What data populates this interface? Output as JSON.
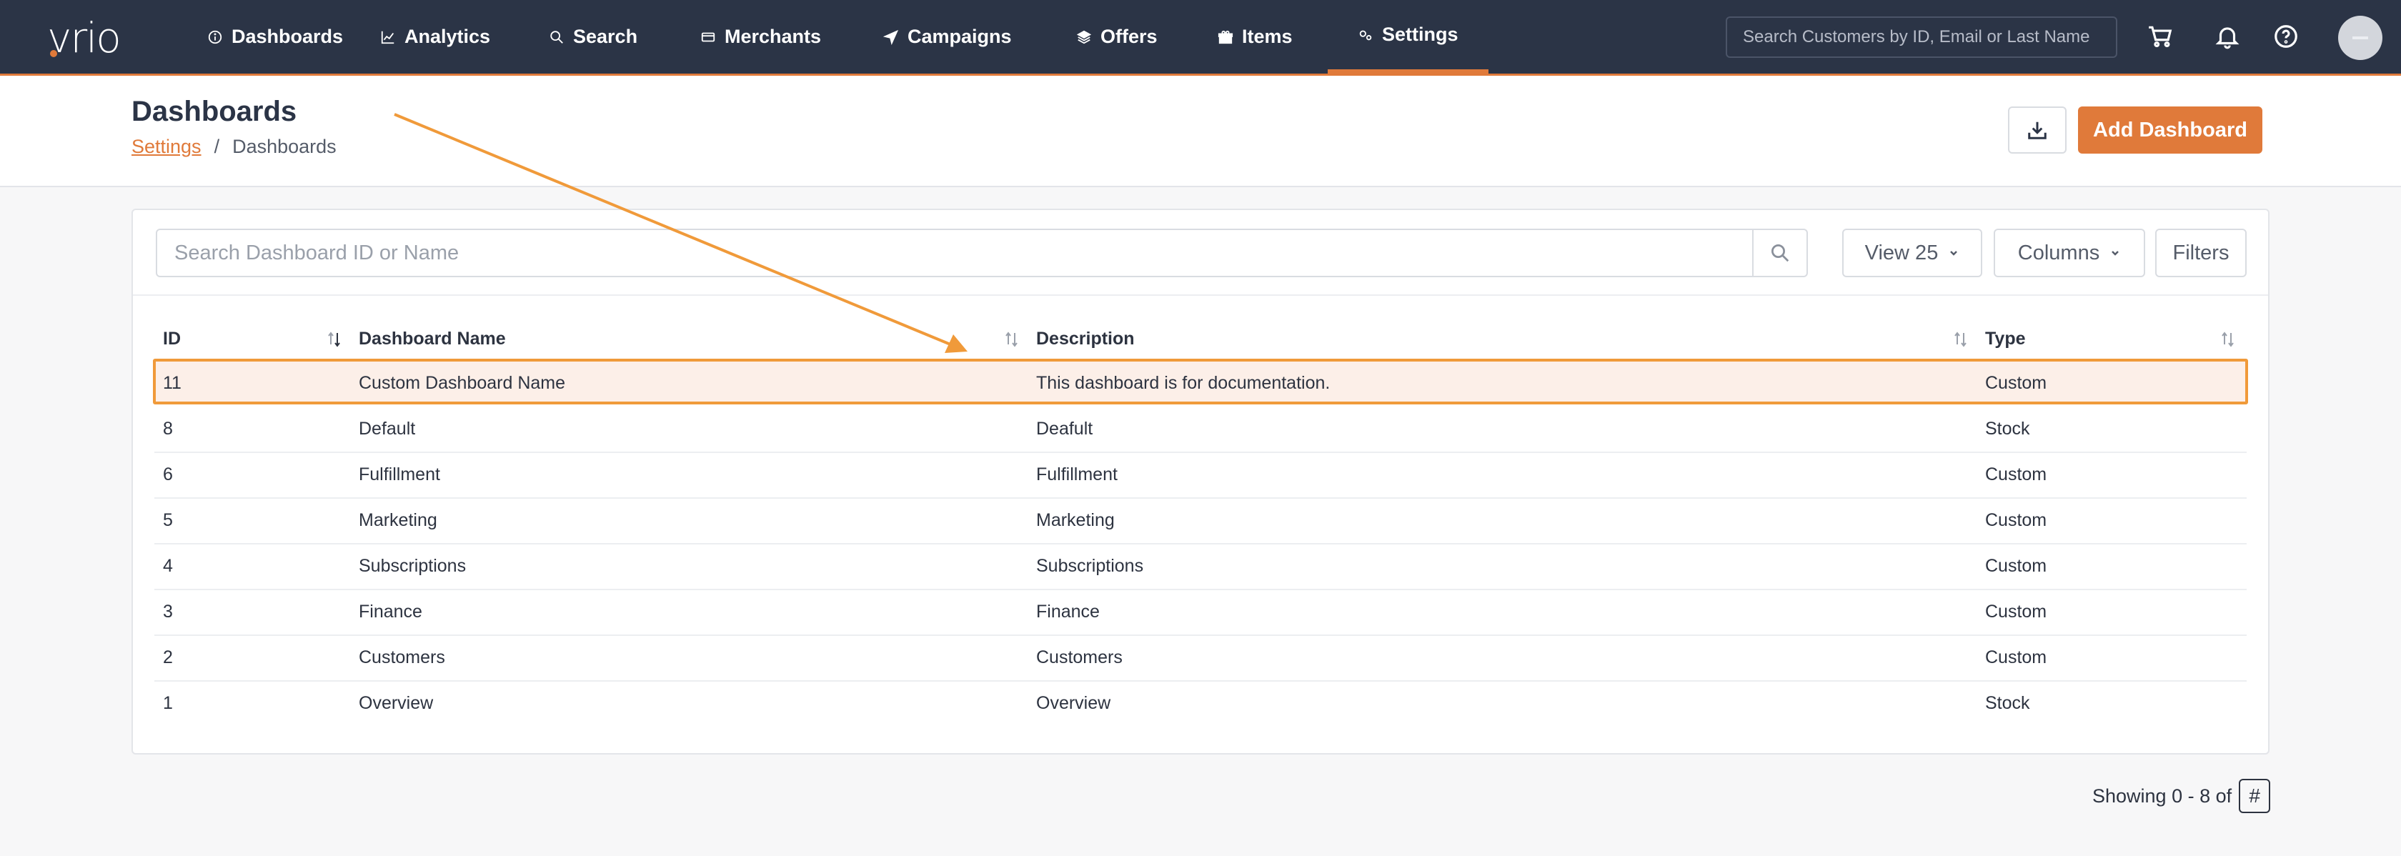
{
  "app": {
    "logo": "vrio"
  },
  "nav": {
    "items": [
      {
        "label": "Dashboards",
        "icon": "info-circle-icon"
      },
      {
        "label": "Analytics",
        "icon": "line-chart-icon"
      },
      {
        "label": "Search",
        "icon": "search-icon"
      },
      {
        "label": "Merchants",
        "icon": "card-icon"
      },
      {
        "label": "Campaigns",
        "icon": "paper-plane-icon"
      },
      {
        "label": "Offers",
        "icon": "layers-icon"
      },
      {
        "label": "Items",
        "icon": "gift-icon"
      },
      {
        "label": "Settings",
        "icon": "gears-icon",
        "active": true
      }
    ],
    "search_placeholder": "Search Customers by ID, Email or Last Name"
  },
  "header": {
    "title": "Dashboards",
    "breadcrumb": {
      "link": "Settings",
      "separator": "/",
      "current": "Dashboards"
    },
    "add_button": "Add Dashboard"
  },
  "toolbar": {
    "search_placeholder": "Search Dashboard ID or Name",
    "view": "View 25",
    "columns": "Columns",
    "filters": "Filters"
  },
  "table": {
    "columns": [
      "ID",
      "Dashboard Name",
      "Description",
      "Type"
    ],
    "rows": [
      {
        "id": "11",
        "name": "Custom Dashboard Name",
        "description": "This dashboard is for documentation.",
        "type": "Custom",
        "highlighted": true
      },
      {
        "id": "8",
        "name": "Default",
        "description": "Deafult",
        "type": "Stock"
      },
      {
        "id": "6",
        "name": "Fulfillment",
        "description": "Fulfillment",
        "type": "Custom"
      },
      {
        "id": "5",
        "name": "Marketing",
        "description": "Marketing",
        "type": "Custom"
      },
      {
        "id": "4",
        "name": "Subscriptions",
        "description": "Subscriptions",
        "type": "Custom"
      },
      {
        "id": "3",
        "name": "Finance",
        "description": "Finance",
        "type": "Custom"
      },
      {
        "id": "2",
        "name": "Customers",
        "description": "Customers",
        "type": "Custom"
      },
      {
        "id": "1",
        "name": "Overview",
        "description": "Overview",
        "type": "Stock"
      }
    ]
  },
  "footer": {
    "showing": "Showing 0 - 8 of",
    "count": "#"
  },
  "colors": {
    "nav_bg": "#2b3446",
    "accent": "#e07a3a",
    "highlight_border": "#f09a3a",
    "highlight_bg": "#fcefe8"
  }
}
